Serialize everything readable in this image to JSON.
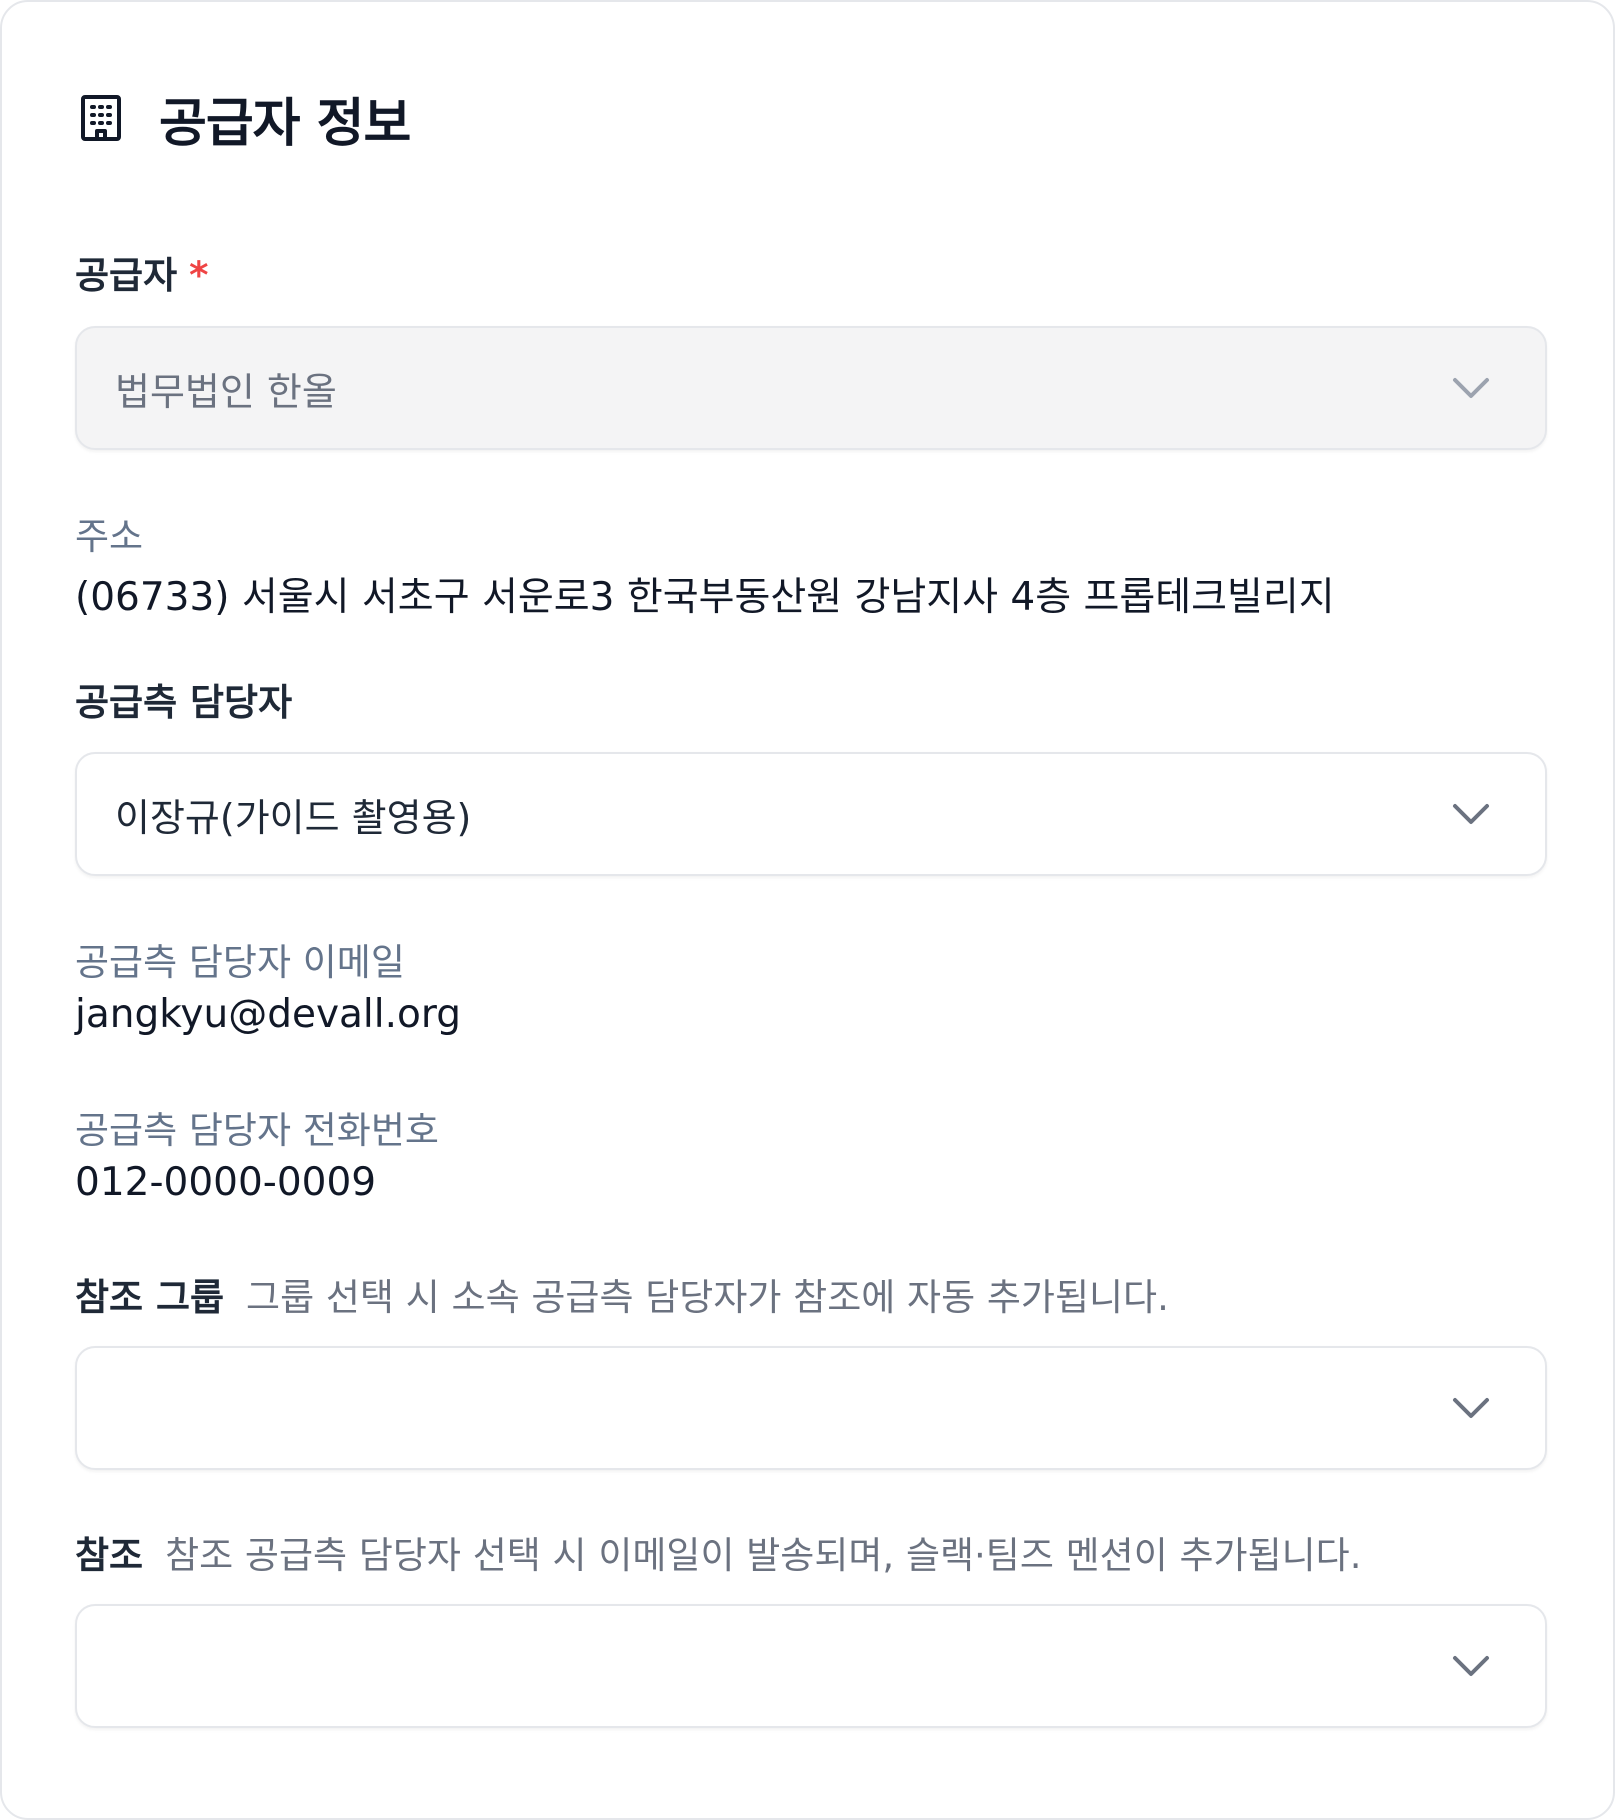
{
  "section": {
    "title": "공급자 정보",
    "icon": "building-icon"
  },
  "supplier": {
    "label": "공급자",
    "required_mark": "*",
    "value": "법무법인 한올",
    "disabled": true
  },
  "address": {
    "label": "주소",
    "value": "(06733) 서울시 서초구 서운로3 한국부동산원 강남지사 4층 프롭테크빌리지"
  },
  "supplier_contact": {
    "label": "공급측 담당자",
    "value": "이장규(가이드 촬영용)"
  },
  "contact_email": {
    "label": "공급측 담당자 이메일",
    "value": "jangkyu@devall.org"
  },
  "contact_phone": {
    "label": "공급측 담당자 전화번호",
    "value": "012-0000-0009"
  },
  "reference_group": {
    "label": "참조 그룹",
    "hint": "그룹 선택 시 소속 공급측 담당자가 참조에 자동 추가됩니다.",
    "value": ""
  },
  "reference": {
    "label": "참조",
    "hint": "참조 공급측 담당자 선택 시 이메일이 발송되며, 슬랙·팀즈 멘션이 추가됩니다.",
    "value": ""
  },
  "colors": {
    "required": "#ef4444",
    "muted_label": "#64748b",
    "disabled_bg": "#f4f4f5",
    "border": "#e5e7eb"
  }
}
